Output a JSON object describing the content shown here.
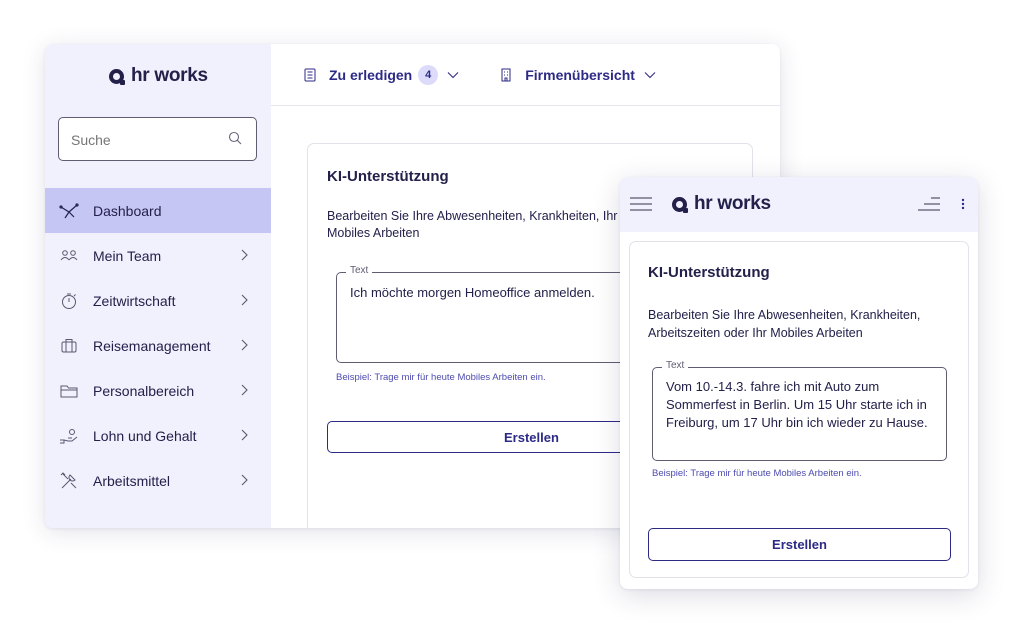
{
  "brand": {
    "name": "hr works",
    "accent": "#2d2a86",
    "sidebar_bg": "#f1f1fd",
    "active_bg": "#c6c6f4"
  },
  "desktop": {
    "search": {
      "placeholder": "Suche"
    },
    "nav": [
      {
        "label": "Dashboard",
        "icon": "dashboard-icon",
        "active": true
      },
      {
        "label": "Mein Team",
        "icon": "team-icon"
      },
      {
        "label": "Zeitwirtschaft",
        "icon": "stopwatch-icon"
      },
      {
        "label": "Reisemanagement",
        "icon": "luggage-icon"
      },
      {
        "label": "Personalbereich",
        "icon": "folder-icon"
      },
      {
        "label": "Lohn und Gehalt",
        "icon": "money-hand-icon"
      },
      {
        "label": "Arbeitsmittel",
        "icon": "tools-icon"
      }
    ],
    "topbar": {
      "todo_label": "Zu erledigen",
      "todo_count": "4",
      "company_label": "Firmenübersicht"
    },
    "card": {
      "title": "KI-Unterstützung",
      "description": "Bearbeiten Sie Ihre Abwesenheiten, Krankheiten, Ihr Mobiles Arbeiten",
      "field_label": "Text",
      "field_value": "Ich möchte morgen Homeoffice anmelden.",
      "hint": "Beispiel: Trage mir für heute Mobiles Arbeiten ein.",
      "button": "Erstellen"
    }
  },
  "mobile": {
    "card": {
      "title": "KI-Unterstützung",
      "description": "Bearbeiten Sie Ihre Abwesenheiten, Krankheiten, Arbeitszeiten oder Ihr Mobiles Arbeiten",
      "field_label": "Text",
      "field_value": "Vom 10.-14.3. fahre ich mit Auto zum Sommerfest in Berlin. Um 15 Uhr starte ich in Freiburg, um 17 Uhr bin ich wieder zu Hause.",
      "hint": "Beispiel: Trage mir für heute Mobiles Arbeiten ein.",
      "button": "Erstellen"
    }
  }
}
